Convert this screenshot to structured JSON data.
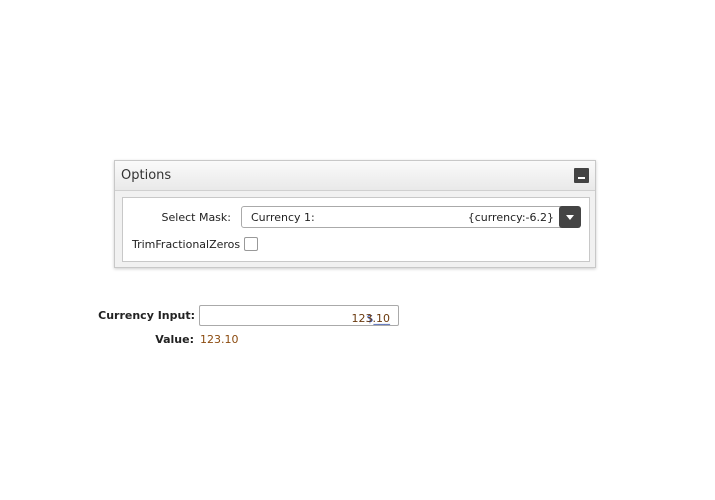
{
  "options": {
    "title": "Options",
    "select_mask_label": "Select Mask:",
    "mask_name": "Currency 1:",
    "mask_format": "{currency:-6.2}",
    "trim_label": "TrimFractionalZeros",
    "trim_checked": false
  },
  "currency": {
    "label": "Currency Input:",
    "prefix": "$___",
    "amount": "123.10",
    "value_label": "Value:",
    "value": "123.10"
  }
}
